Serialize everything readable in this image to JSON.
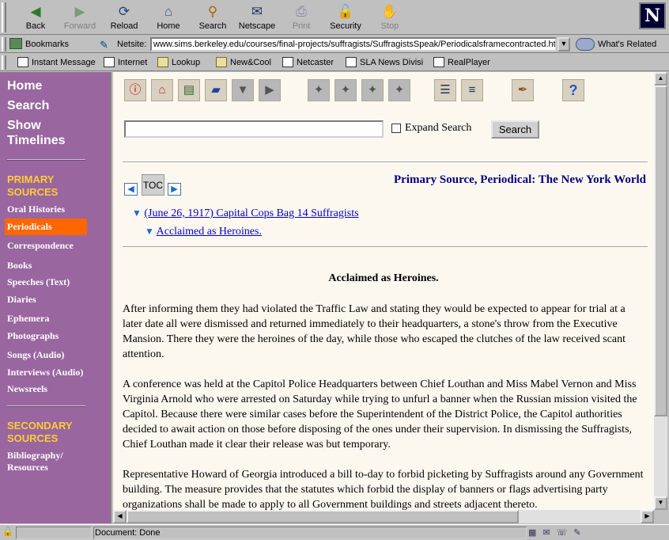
{
  "nav_toolbar": {
    "buttons": [
      {
        "label": "Back",
        "icon": "back-arrow-icon",
        "glyph": "◀",
        "enabled": true
      },
      {
        "label": "Forward",
        "icon": "forward-arrow-icon",
        "glyph": "▶",
        "enabled": false
      },
      {
        "label": "Reload",
        "icon": "reload-icon",
        "glyph": "⟳",
        "enabled": true
      },
      {
        "label": "Home",
        "icon": "home-icon",
        "glyph": "⌂",
        "enabled": true
      },
      {
        "label": "Search",
        "icon": "search-icon",
        "glyph": "⚲",
        "enabled": true
      },
      {
        "label": "Netscape",
        "icon": "netscape-my-icon",
        "glyph": "✉",
        "enabled": true
      },
      {
        "label": "Print",
        "icon": "print-icon",
        "glyph": "⎙",
        "enabled": false
      },
      {
        "label": "Security",
        "icon": "security-lock-icon",
        "glyph": "🔓",
        "enabled": true
      },
      {
        "label": "Stop",
        "icon": "stop-icon",
        "glyph": "✋",
        "enabled": false
      }
    ],
    "logo": "N"
  },
  "location_toolbar": {
    "bookmarks_label": "Bookmarks",
    "netsite_label": "Netsite:",
    "url": "www.sims.berkeley.edu/courses/final-projects/suffragists/SuffragistsSpeak/Periodicalsframecontracted.html",
    "related_label": "What's Related"
  },
  "personal_toolbar": {
    "items": [
      {
        "label": "Instant Message",
        "icon": "instant-message-icon"
      },
      {
        "label": "Internet",
        "icon": "internet-icon"
      },
      {
        "label": "Lookup",
        "icon": "folder-icon"
      },
      {
        "label": "New&Cool",
        "icon": "folder-icon"
      },
      {
        "label": "Netcaster",
        "icon": "netcaster-icon"
      },
      {
        "label": "SLA News Divisi",
        "icon": "bookmark-icon"
      },
      {
        "label": "RealPlayer",
        "icon": "bookmark-icon"
      }
    ]
  },
  "sidebar": {
    "top_links": [
      "Home",
      "Search",
      "Show",
      "Timelines"
    ],
    "primary_heading": [
      "PRIMARY",
      "SOURCES"
    ],
    "primary_links": [
      "Oral Histories",
      "Periodicals",
      "Correspondence",
      "Books",
      "Speeches (Text)",
      "Diaries",
      "Ephemera",
      "Photographs",
      "Songs (Audio)",
      "Interviews (Audio)",
      "Newsreels"
    ],
    "active_link": "Periodicals",
    "secondary_heading": [
      "SECONDARY",
      "SOURCES"
    ],
    "secondary_links": [
      "Bibliography/",
      "Resources"
    ]
  },
  "main": {
    "toolbar_icons": [
      "info-icon",
      "house-icon",
      "books-icon",
      "book-icon",
      "collapse-icon",
      "expand-icon",
      "suffragist-icon",
      "suffragist-icon",
      "suffragist-icon",
      "suffragist-icon",
      "list-icon",
      "bullet-list-icon",
      "pen-stand-icon",
      "help-icon"
    ],
    "search": {
      "placeholder": "",
      "expand_label": "Expand Search",
      "button_label": "Search"
    },
    "toc_label": "TOC",
    "source_title": "Primary Source, Periodical: The New York World",
    "tree_level1": "(June 26, 1917) Capital Cops Bag 14 Suffragists",
    "tree_level2": "Acclaimed as Heroines.",
    "article_title": "Acclaimed as Heroines.",
    "paragraphs": [
      "After informing them they had violated the Traffic Law and stating they would be expected to appear for trial at a later date all were dismissed and returned immediately to their headquarters, a stone's throw from the Executive Mansion. There they were the heroines of the day, while those who escaped the clutches of the law received scant attention.",
      "A conference was held at the Capitol Police Headquarters between Chief Louthan and Miss Mabel Vernon and Miss Virginia Arnold who were arrested on Saturday while trying to unfurl a banner when the Russian mission visited the Capitol. Because there were similar cases before the Superintendent of the District Police, the Capitol authorities decided to await action on those before disposing of the ones under their supervision. In dismissing the Suffragists, Chief Louthan made it clear their release was but temporary.",
      "Representative Howard of Georgia introduced a bill to-day to forbid picketing by Suffragists around any Government building. The measure provides that the statutes which forbid the display of banners or flags advertising party organizations shall be made to apply to all Government buildings and streets adjacent thereto."
    ]
  },
  "statusbar": {
    "text": "Document: Done"
  }
}
